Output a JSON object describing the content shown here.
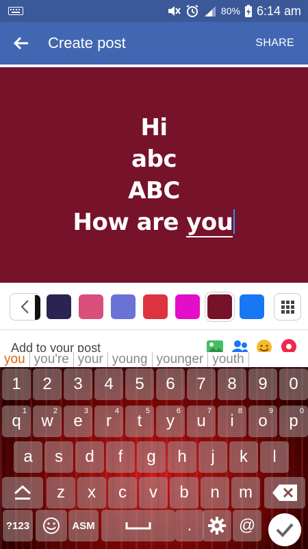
{
  "status_bar": {
    "battery": "80%",
    "time": "6:14 am"
  },
  "app_bar": {
    "title": "Create post",
    "share_label": "SHARE"
  },
  "post": {
    "background": "#76122a",
    "lines": [
      "Hi",
      "abc",
      "ABC"
    ],
    "last_line_prefix": "How are ",
    "last_line_underlined": "you"
  },
  "color_row": {
    "swatches": [
      {
        "color": "#2b2450",
        "selected": false
      },
      {
        "color": "#d94f7b",
        "selected": false
      },
      {
        "color": "#6b72d6",
        "selected": false
      },
      {
        "color": "#dd3340",
        "selected": false
      },
      {
        "color": "#e50ec8",
        "selected": false
      },
      {
        "color": "#76122a",
        "selected": true
      },
      {
        "color": "#1877f2",
        "selected": false
      }
    ]
  },
  "add_to_post": {
    "label": "Add to your post"
  },
  "suggestions": [
    "you",
    "you're",
    "your",
    "young",
    "younger",
    "youth"
  ],
  "keyboard": {
    "number_row": [
      "1",
      "2",
      "3",
      "4",
      "5",
      "6",
      "7",
      "8",
      "9",
      "0"
    ],
    "row1": [
      {
        "k": "q",
        "h": "1"
      },
      {
        "k": "w",
        "h": "2"
      },
      {
        "k": "e",
        "h": "3"
      },
      {
        "k": "r",
        "h": "4"
      },
      {
        "k": "t",
        "h": "5"
      },
      {
        "k": "y",
        "h": "6"
      },
      {
        "k": "u",
        "h": "7"
      },
      {
        "k": "i",
        "h": "8"
      },
      {
        "k": "o",
        "h": "9"
      },
      {
        "k": "p",
        "h": "0"
      }
    ],
    "row2": [
      "a",
      "s",
      "d",
      "f",
      "g",
      "h",
      "j",
      "k",
      "l"
    ],
    "row3": [
      "z",
      "x",
      "c",
      "v",
      "b",
      "n",
      "m"
    ],
    "symbols_label": "?123",
    "lang_label": "ASM",
    "period": ".",
    "at": "@"
  }
}
